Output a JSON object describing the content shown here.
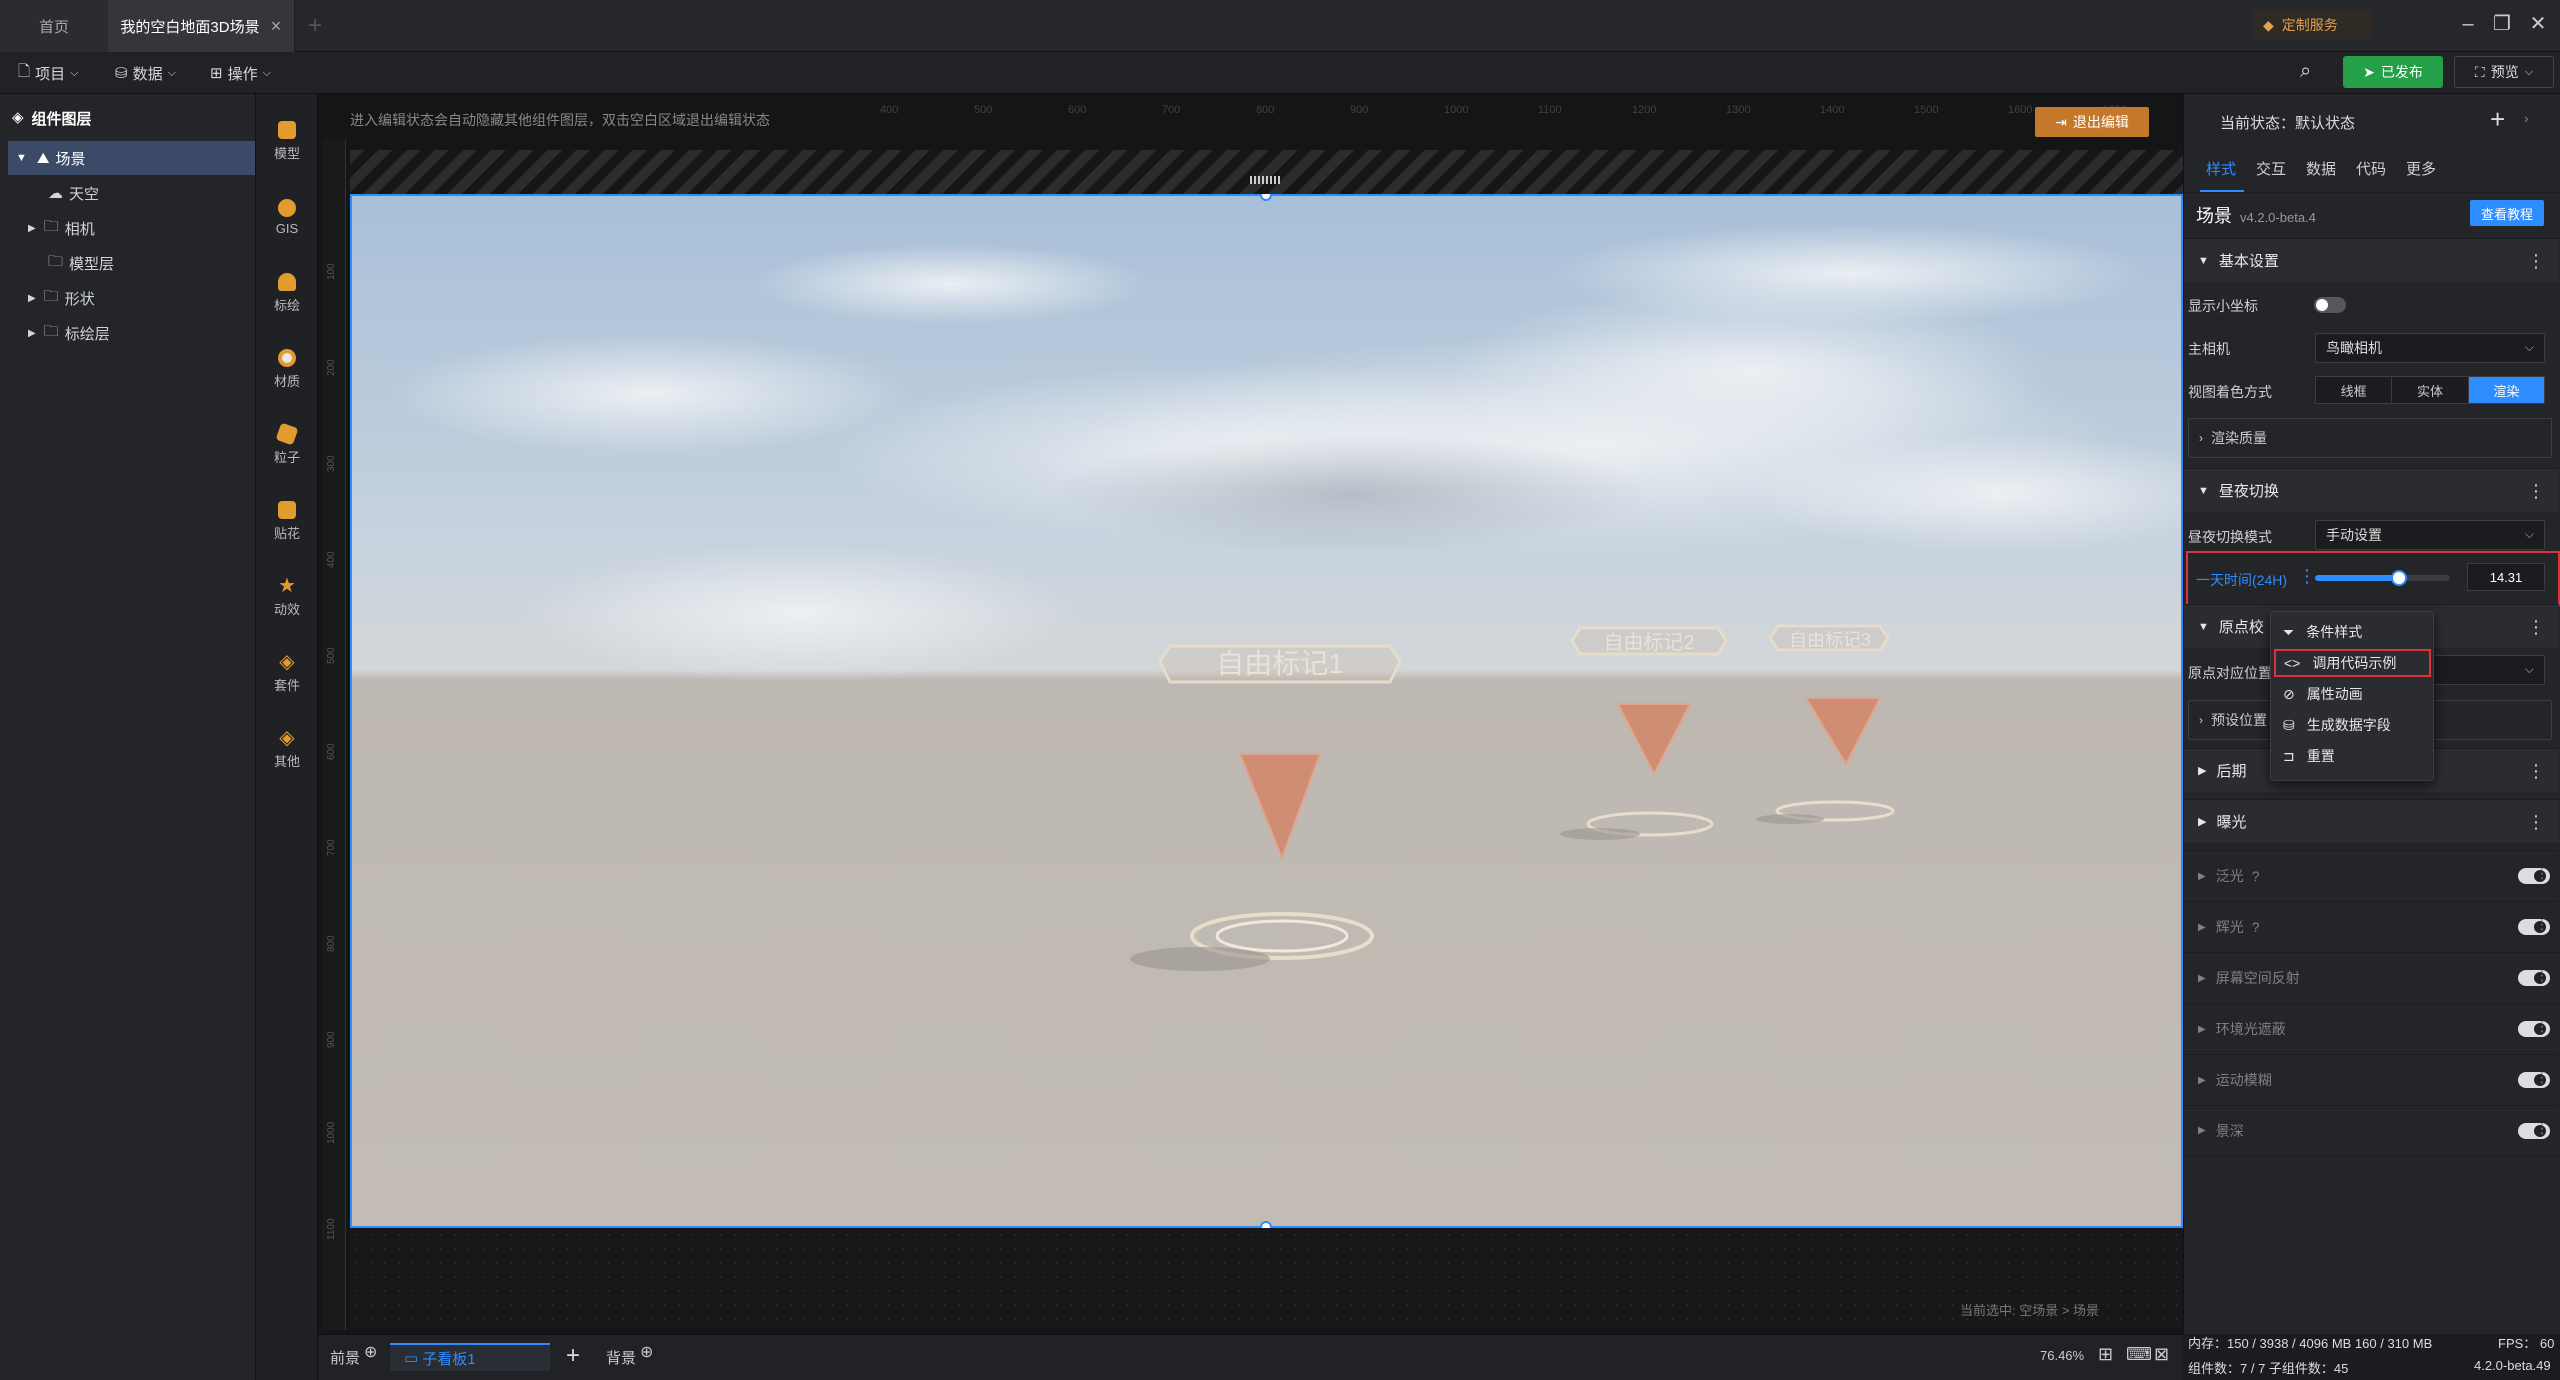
{
  "tabs": {
    "home": "首页",
    "active": "我的空白地面3D场景"
  },
  "custom_service": "定制服务",
  "menu": {
    "project": "项目",
    "data": "数据",
    "operate": "操作"
  },
  "publish": "已发布",
  "preview": "预览",
  "layers": {
    "title": "组件图层",
    "items": [
      "场景",
      "天空",
      "相机",
      "模型层",
      "形状",
      "标绘层"
    ]
  },
  "tools": [
    "模型",
    "GIS",
    "标绘",
    "材质",
    "粒子",
    "贴花",
    "动效",
    "套件",
    "其他"
  ],
  "canvas": {
    "hint": "进入编辑状态会自动隐藏其他组件图层，双击空白区域退出编辑状态",
    "exit": "退出编辑",
    "selected": "当前选中: 空场景 > 场景",
    "marker1": "自由标记1",
    "marker2": "自由标记2",
    "marker3": "自由标记3",
    "ruler_top": [
      "400",
      "500",
      "600",
      "700",
      "800",
      "900",
      "1000",
      "1100",
      "1200",
      "1300",
      "1400",
      "1500",
      "1600",
      "1700"
    ],
    "ruler_left": [
      "100",
      "200",
      "300",
      "400",
      "500",
      "600",
      "700",
      "800",
      "900",
      "1000",
      "1100"
    ]
  },
  "bottom": {
    "front": "前景",
    "sub": "子看板1",
    "back": "背景",
    "zoom": "76.46%"
  },
  "panel": {
    "state": "当前状态：默认状态",
    "tabs": [
      "样式",
      "交互",
      "数据",
      "代码",
      "更多"
    ],
    "name": "场景",
    "version": "v4.2.0-beta.4",
    "tutorial": "查看教程",
    "basic": "基本设置",
    "show_axis": "显示小坐标",
    "camera_label": "主相机",
    "camera_value": "鸟瞰相机",
    "shading_label": "视图着色方式",
    "shading": [
      "线框",
      "实体",
      "渲染"
    ],
    "render_quality": "渲染质量",
    "daynight": "昼夜切换",
    "dn_mode_label": "昼夜切换模式",
    "dn_mode_value": "手动设置",
    "time_label": "一天时间(24H)",
    "time_value": "14.31",
    "time_fraction": 0.62,
    "origin": "原点校",
    "origin_pos": "原点对应位置",
    "preset": "预设位置",
    "post": "后期",
    "exposure": "曝光",
    "effects": [
      "泛光",
      "辉光",
      "屏幕空间反射",
      "环境光遮蔽",
      "运动模糊",
      "景深"
    ]
  },
  "context_menu": [
    "条件样式",
    "调用代码示例",
    "属性动画",
    "生成数据字段",
    "重置"
  ],
  "status": {
    "mem": "内存：150 / 3938 / 4096 MB  160 / 310 MB",
    "fps": "FPS： 60",
    "count": "组件数：7 / 7   子组件数：45",
    "version": "4.2.0-beta.49"
  },
  "colors": {
    "accent": "#2f8cff",
    "publish": "#24a148",
    "exit": "#c4782a",
    "highlight": "#e0313a"
  }
}
